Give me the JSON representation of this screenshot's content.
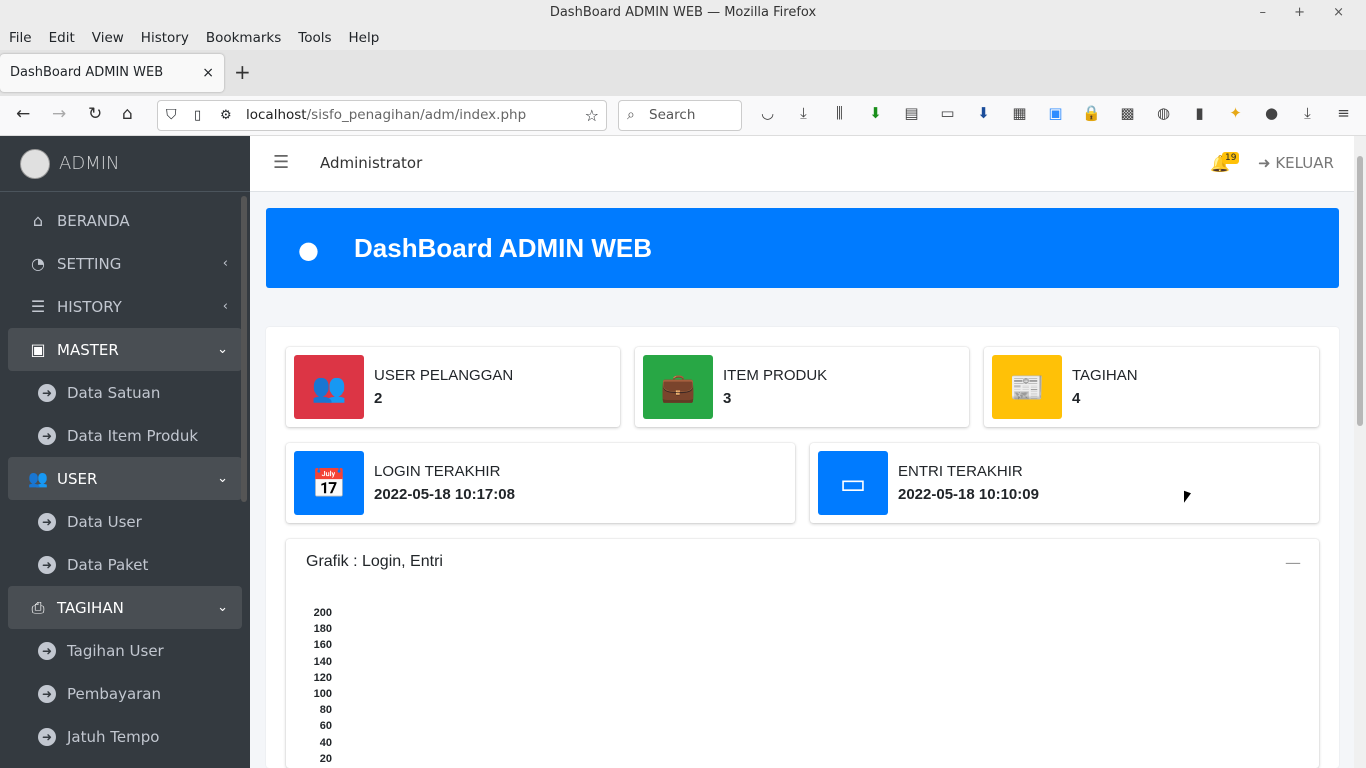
{
  "window": {
    "title": "DashBoard ADMIN WEB — Mozilla Firefox",
    "controls": "– + ×"
  },
  "menubar": [
    "File",
    "Edit",
    "View",
    "History",
    "Bookmarks",
    "Tools",
    "Help"
  ],
  "tab": {
    "title": "DashBoard ADMIN WEB",
    "close": "×",
    "new": "+"
  },
  "navbar": {
    "url_host": "localhost",
    "url_path": "/sisfo_penagihan/adm/index.php",
    "search_placeholder": "Search"
  },
  "sidebar": {
    "brand": "ADMIN",
    "items": [
      {
        "label": "BERANDA",
        "icon": "home-icon",
        "glyph": "⌂"
      },
      {
        "label": "SETTING",
        "icon": "gauge-icon",
        "glyph": "◔",
        "arrow": "‹"
      },
      {
        "label": "HISTORY",
        "icon": "list-icon",
        "glyph": "☰",
        "arrow": "‹"
      },
      {
        "label": "MASTER",
        "icon": "briefcase-icon",
        "glyph": "▣",
        "arrow": "⌄"
      },
      {
        "label": "Data Satuan"
      },
      {
        "label": "Data Item Produk"
      },
      {
        "label": "USER",
        "icon": "users-icon",
        "glyph": "👥",
        "arrow": "⌄"
      },
      {
        "label": "Data User"
      },
      {
        "label": "Data Paket"
      },
      {
        "label": "TAGIHAN",
        "icon": "printer-icon",
        "glyph": "⎙",
        "arrow": "⌄"
      },
      {
        "label": "Tagihan User"
      },
      {
        "label": "Pembayaran"
      },
      {
        "label": "Jatuh Tempo"
      }
    ]
  },
  "topnav": {
    "user": "Administrator",
    "notif_count": "19",
    "logout": "KELUAR"
  },
  "hero": {
    "title": "DashBoard ADMIN WEB"
  },
  "stats": [
    {
      "label": "USER PELANGGAN",
      "value": "2",
      "color": "#dc3545",
      "icon": "users-icon"
    },
    {
      "label": "ITEM PRODUK",
      "value": "3",
      "color": "#28a745",
      "icon": "briefcase-icon"
    },
    {
      "label": "TAGIHAN",
      "value": "4",
      "color": "#ffc107",
      "icon": "newspaper-icon"
    },
    {
      "label": "LOGIN TERAKHIR",
      "value": "2022-05-18 10:17:08",
      "color": "#007bff",
      "icon": "calendar-icon"
    },
    {
      "label": "ENTRI TERAKHIR",
      "value": "2022-05-18 10:10:09",
      "color": "#007bff",
      "icon": "calendar-icon"
    }
  ],
  "chart": {
    "title": "Grafik : Login, Entri",
    "collapse": "—"
  },
  "chart_data": {
    "type": "bar",
    "title": "Grafik : Login, Entri",
    "yticks": [
      200,
      180,
      160,
      140,
      120,
      100,
      80,
      60,
      40,
      20
    ],
    "categories": [],
    "series": []
  }
}
